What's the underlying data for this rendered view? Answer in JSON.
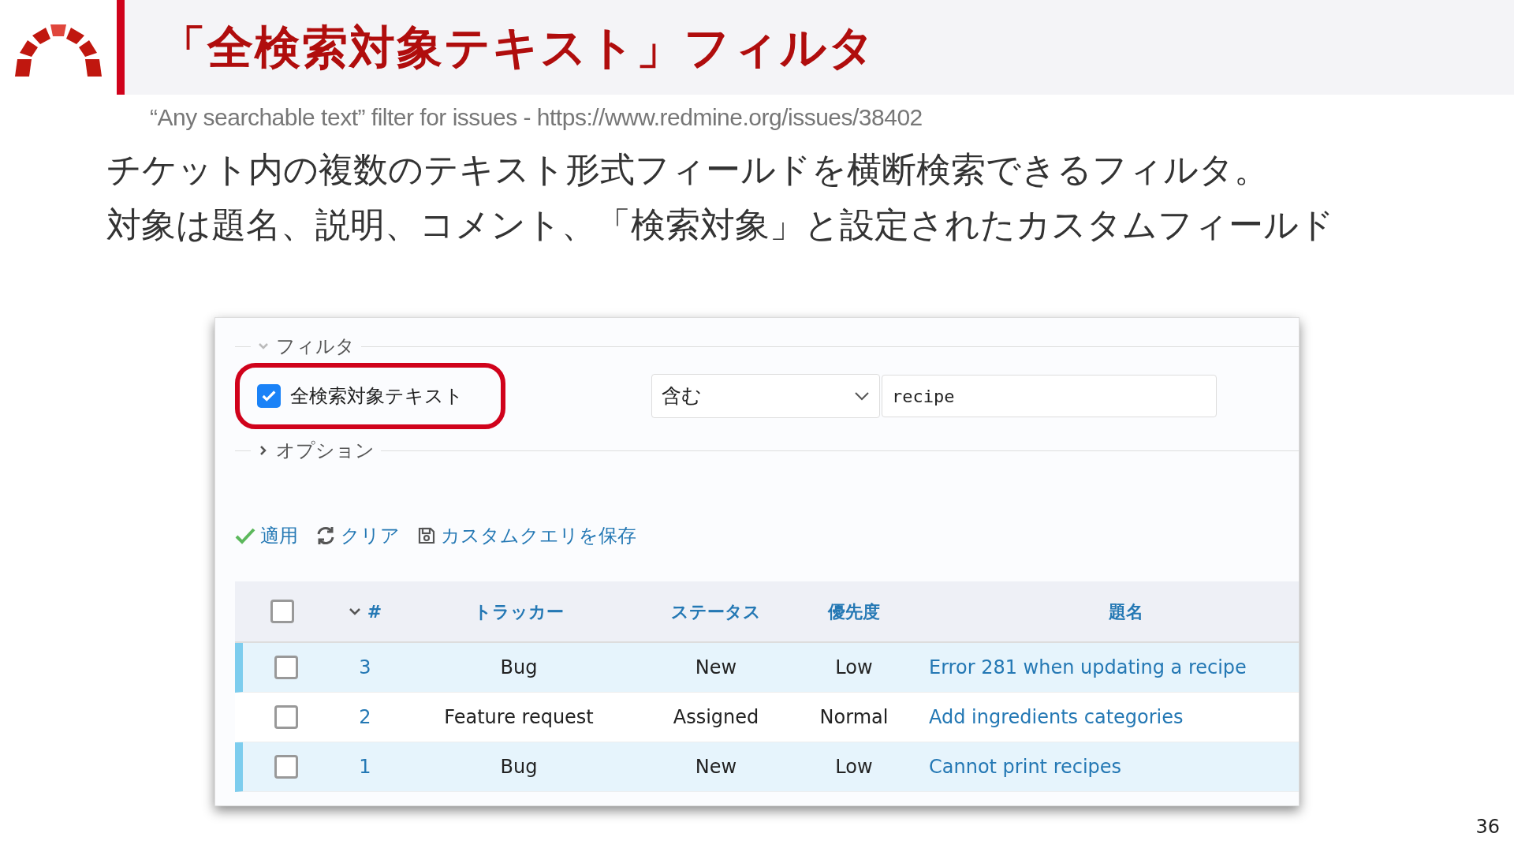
{
  "slide": {
    "title": "「全検索対象テキスト」フィルタ",
    "subtitle": "“Any searchable text” filter for issues - https://www.redmine.org/issues/38402",
    "body": [
      "チケット内の複数のテキスト形式フィールドを横断検索できるフィルタ。",
      "対象は題名、説明、コメント、「検索対象」と設定されたカスタムフィールド"
    ],
    "page_number": "36"
  },
  "filters": {
    "legend": "フィルタ",
    "expanded": true,
    "filter": {
      "label": "全検索対象テキスト",
      "checked": true,
      "operator": "含む",
      "value": "recipe"
    }
  },
  "options": {
    "legend": "オプション",
    "expanded": false
  },
  "actions": [
    {
      "kind": "apply",
      "label": "適用"
    },
    {
      "kind": "clear",
      "label": "クリア"
    },
    {
      "kind": "save",
      "label": "カスタムクエリを保存"
    }
  ],
  "table": {
    "columns": [
      "#",
      "トラッカー",
      "ステータス",
      "優先度",
      "題名"
    ],
    "header_checked": false,
    "rows": [
      {
        "id": "3",
        "tracker": "Bug",
        "status": "New",
        "priority": "Low",
        "subject": "Error 281 when updating a recipe",
        "highlighted": true,
        "checked": false
      },
      {
        "id": "2",
        "tracker": "Feature request",
        "status": "Assigned",
        "priority": "Normal",
        "subject": "Add ingredients categories",
        "highlighted": false,
        "checked": false
      },
      {
        "id": "1",
        "tracker": "Bug",
        "status": "New",
        "priority": "Low",
        "subject": "Cannot print recipes",
        "highlighted": true,
        "checked": false
      }
    ]
  }
}
